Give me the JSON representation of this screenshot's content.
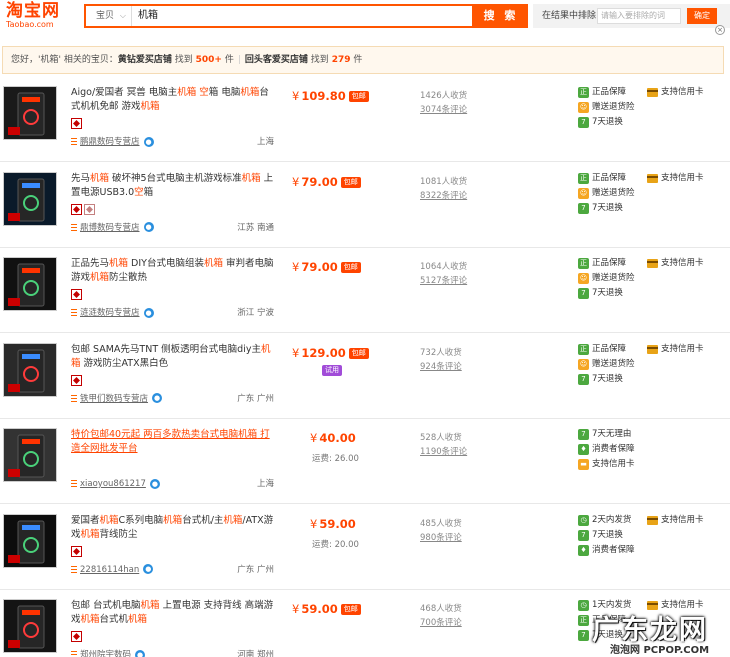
{
  "header": {
    "logo_main": "淘宝网",
    "logo_sub": "Taobao.com",
    "search_category": "宝贝",
    "search_query": "机箱",
    "search_button": "搜 索",
    "in_result_label": "在结果中排除",
    "in_result_placeholder": "请输入要排除的词",
    "in_result_button": "确定",
    "close_label": "×"
  },
  "notice": {
    "prefix": "您好，",
    "query": "'机箱'",
    "middle": "相关的宝贝：",
    "shop_type_1": "黄钻爱买店铺",
    "found_1_pre": "找到",
    "found_1": "500+",
    "found_1_post": "件",
    "separator": "|",
    "shop_type_2": "回头客爱买店铺",
    "found_2_pre": "找到",
    "found_2": "279",
    "found_2_post": "件"
  },
  "services_labels": {
    "genuine": "正品保障",
    "freight_ins": "赠送退货险",
    "return7": "7天退换",
    "no_reason7": "7天无理由",
    "consumer": "消费者保障",
    "ship2": "2天内发货",
    "ship1": "1天内发货",
    "credit": "支持信用卡"
  },
  "items": [
    {
      "title_parts": [
        "Aigo/爱国者 冥兽 电脑主",
        "机箱",
        " ",
        "空",
        "箱 电脑",
        "机箱",
        "台式机机免邮 游戏",
        "机箱"
      ],
      "price": "109.80",
      "pill": "包邮",
      "pill2": "",
      "freight": "",
      "shop": "鹏鼎数码专营店",
      "location": "上海",
      "sold": "1426人收货",
      "reviews": "3074条评论",
      "services": [
        "genuine",
        "freight_ins",
        "return7"
      ],
      "credit": true,
      "badges": 1
    },
    {
      "title_parts": [
        "先马",
        "机箱",
        " 破坏神5台式电脑主机游戏标准",
        "机箱",
        " 上置电源USB3.0",
        "空",
        "箱",
        "",
        ""
      ],
      "price": "79.00",
      "pill": "包邮",
      "pill2": "",
      "freight": "",
      "shop": "鼎博数码专营店",
      "location": "江苏 南通",
      "sold": "1081人收货",
      "reviews": "8322条评论",
      "services": [
        "genuine",
        "freight_ins",
        "return7"
      ],
      "credit": true,
      "badges": 2
    },
    {
      "title_parts": [
        "正品先马",
        "机箱",
        " DIY台式电脑组装",
        "机箱",
        " 审判者电脑游戏",
        "机箱",
        "防尘散热",
        "",
        ""
      ],
      "price": "79.00",
      "pill": "包邮",
      "pill2": "",
      "freight": "",
      "shop": "涟涟数码专营店",
      "location": "浙江 宁波",
      "sold": "1064人收货",
      "reviews": "5127条评论",
      "services": [
        "genuine",
        "freight_ins",
        "return7"
      ],
      "credit": true,
      "badges": 1
    },
    {
      "title_parts": [
        "包邮 SAMA先马TNT 侧板透明台式电脑diy主",
        "机箱",
        " 游戏防尘ATX黑白色",
        "",
        "",
        "",
        "",
        "",
        ""
      ],
      "price": "129.00",
      "pill": "包邮",
      "pill2": "试用",
      "freight": "",
      "shop": "铁甲们数码专营店",
      "location": "广东 广州",
      "sold": "732人收货",
      "reviews": "924条评论",
      "services": [
        "genuine",
        "freight_ins",
        "return7"
      ],
      "credit": true,
      "badges": 1
    },
    {
      "title_parts": [
        "特价包邮40元起 两百多款热卖台式电脑",
        "机箱",
        " 打造全网批发平台",
        "",
        "",
        "",
        "",
        "",
        ""
      ],
      "price": "40.00",
      "pill": "",
      "pill2": "",
      "freight": "运费: 26.00",
      "shop": "xiaoyou861217",
      "location": "上海",
      "sold": "528人收货",
      "reviews": "1190条评论",
      "services": [
        "no_reason7",
        "consumer",
        "credit_svc"
      ],
      "credit": false,
      "badges": 0,
      "link_title": true
    },
    {
      "title_parts": [
        "爱国者",
        "机箱",
        "C系列电脑",
        "机箱",
        "台式机/主",
        "机箱",
        "/ATX游戏",
        "机箱",
        "背线防尘"
      ],
      "price": "59.00",
      "pill": "",
      "pill2": "",
      "freight": "运费: 20.00",
      "shop": "22816114han",
      "location": "广东 广州",
      "sold": "485人收货",
      "reviews": "980条评论",
      "services": [
        "ship2",
        "return7",
        "consumer"
      ],
      "credit": true,
      "badges": 1
    },
    {
      "title_parts": [
        "包邮 台式机电脑",
        "机箱",
        " 上置电源 支持背线 高端游戏",
        "机箱",
        "台式机",
        "机箱",
        "",
        "",
        ""
      ],
      "price": "59.00",
      "pill": "包邮",
      "pill2": "",
      "freight": "",
      "shop": "郑州院宇数码",
      "location": "河南 郑州",
      "sold": "468人收货",
      "reviews": "700条评论",
      "services": [
        "ship1",
        "genuine",
        "return7"
      ],
      "credit": true,
      "badges": 1
    }
  ],
  "watermark": {
    "main": "广东龙网",
    "sub": "泡泡网 PCPOP.COM"
  },
  "colors": {
    "accent": "#ff4400",
    "search_border": "#ff5500",
    "service_green": "#4ca83f",
    "service_orange": "#f5a623"
  }
}
